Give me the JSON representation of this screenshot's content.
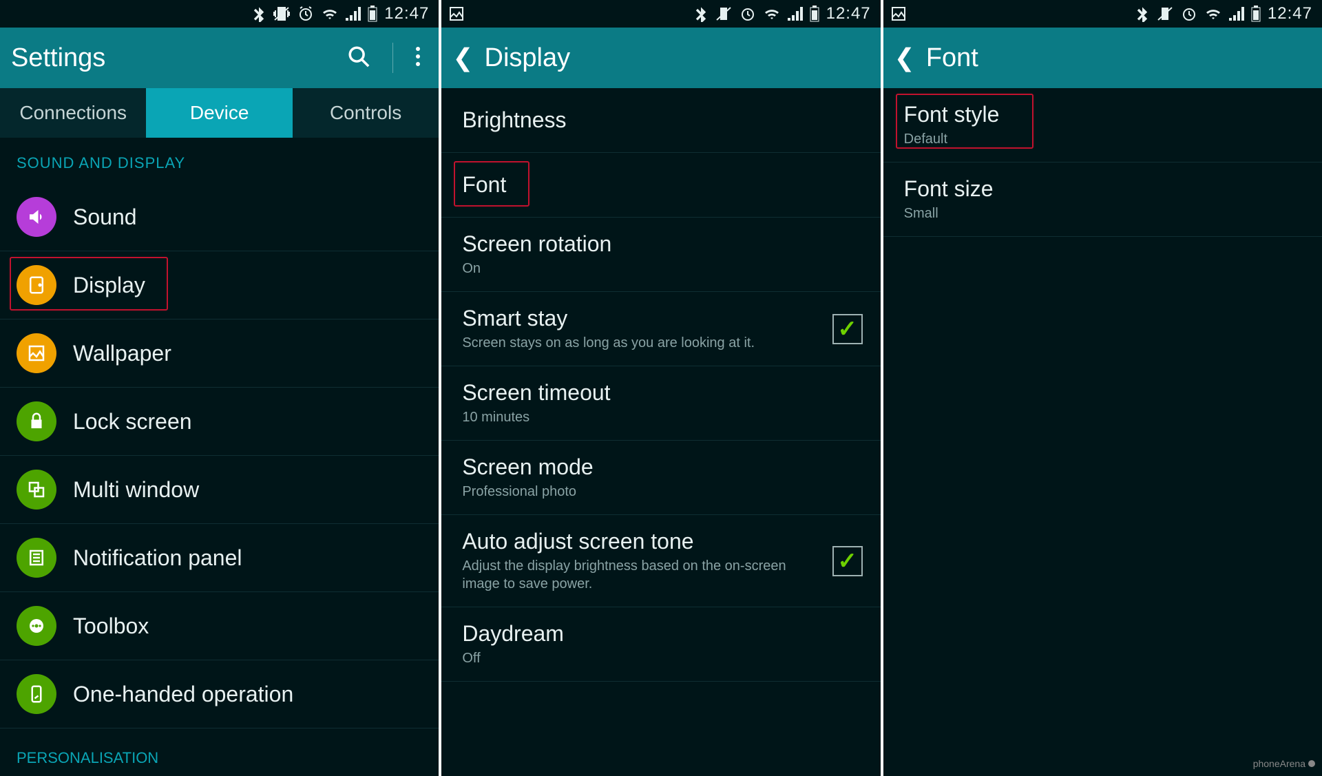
{
  "status": {
    "time": "12:47",
    "icons": [
      "bluetooth",
      "vibrate",
      "alarm",
      "wifi",
      "signal",
      "battery"
    ]
  },
  "screen1": {
    "title": "Settings",
    "tabs": [
      "Connections",
      "Device",
      "Controls"
    ],
    "active_tab": 1,
    "section1_header": "SOUND AND DISPLAY",
    "items": [
      {
        "label": "Sound",
        "icon": "sound",
        "color": "purple"
      },
      {
        "label": "Display",
        "icon": "display",
        "color": "orange",
        "highlight": true
      },
      {
        "label": "Wallpaper",
        "icon": "wallpaper",
        "color": "orange"
      },
      {
        "label": "Lock screen",
        "icon": "lock",
        "color": "green"
      },
      {
        "label": "Multi window",
        "icon": "multiwindow",
        "color": "green"
      },
      {
        "label": "Notification panel",
        "icon": "notification",
        "color": "green"
      },
      {
        "label": "Toolbox",
        "icon": "toolbox",
        "color": "green"
      },
      {
        "label": "One-handed operation",
        "icon": "onehand",
        "color": "green"
      }
    ],
    "section2_header": "PERSONALISATION"
  },
  "screen2": {
    "title": "Display",
    "items": [
      {
        "label": "Brightness"
      },
      {
        "label": "Font",
        "highlight": true
      },
      {
        "label": "Screen rotation",
        "sub": "On"
      },
      {
        "label": "Smart stay",
        "sub": "Screen stays on as long as you are looking at it.",
        "checked": true
      },
      {
        "label": "Screen timeout",
        "sub": "10 minutes"
      },
      {
        "label": "Screen mode",
        "sub": "Professional photo"
      },
      {
        "label": "Auto adjust screen tone",
        "sub": "Adjust the display brightness based on the on-screen image to save power.",
        "checked": true
      },
      {
        "label": "Daydream",
        "sub": "Off"
      }
    ]
  },
  "screen3": {
    "title": "Font",
    "items": [
      {
        "label": "Font style",
        "sub": "Default",
        "highlight": true
      },
      {
        "label": "Font size",
        "sub": "Small"
      }
    ]
  },
  "watermark": "phoneArena"
}
